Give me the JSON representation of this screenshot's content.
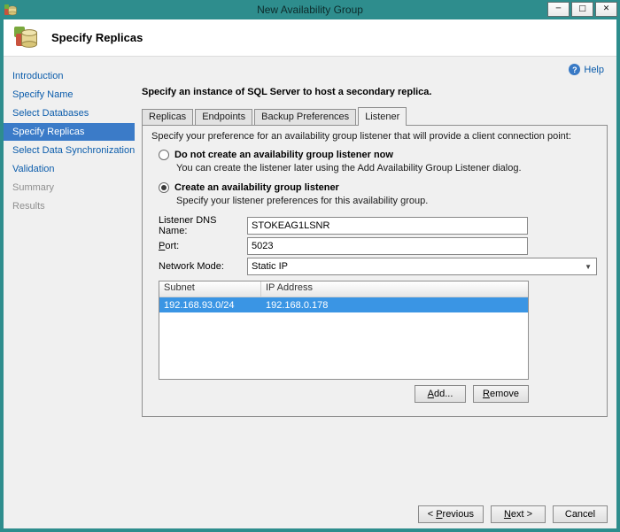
{
  "window": {
    "title": "New Availability Group",
    "controls": {
      "minimize": "─",
      "maximize": "□",
      "close": "✕"
    }
  },
  "header": {
    "title": "Specify Replicas"
  },
  "sidebar": {
    "items": [
      {
        "label": "Introduction",
        "state": "link"
      },
      {
        "label": "Specify Name",
        "state": "link"
      },
      {
        "label": "Select Databases",
        "state": "link"
      },
      {
        "label": "Specify Replicas",
        "state": "active"
      },
      {
        "label": "Select Data Synchronization",
        "state": "link"
      },
      {
        "label": "Validation",
        "state": "link"
      },
      {
        "label": "Summary",
        "state": "disabled"
      },
      {
        "label": "Results",
        "state": "disabled"
      }
    ]
  },
  "main": {
    "help_label": "Help",
    "help_icon_glyph": "?",
    "instruction": "Specify an instance of SQL Server to host a secondary replica.",
    "tabs": [
      {
        "label": "Replicas",
        "active": false
      },
      {
        "label": "Endpoints",
        "active": false
      },
      {
        "label": "Backup Preferences",
        "active": false
      },
      {
        "label": "Listener",
        "active": true
      }
    ],
    "listener": {
      "description": "Specify your preference for an availability group listener that will provide a client connection point:",
      "radio_no_listener": {
        "label": "Do not create an availability group listener now",
        "sublabel": "You can create the listener later using the Add Availability Group Listener dialog.",
        "selected": false
      },
      "radio_create_listener": {
        "label": "Create an availability group listener",
        "sublabel": "Specify your listener preferences for this availability group.",
        "selected": true
      },
      "fields": {
        "dns_name_label": "Listener DNS Name:",
        "dns_name_value": "STOKEAG1LSNR",
        "port_label": "Port:",
        "port_value": "5023",
        "network_mode_label": "Network Mode:",
        "network_mode_value": "Static IP",
        "combo_arrow_glyph": "▼"
      },
      "table": {
        "columns": [
          "Subnet",
          "IP Address"
        ],
        "rows": [
          {
            "subnet": "192.168.93.0/24",
            "ip": "192.168.0.178",
            "selected": true
          }
        ]
      },
      "add_button": "Add...",
      "remove_button": "Remove"
    }
  },
  "footer": {
    "previous": "< Previous",
    "next": "Next >",
    "cancel": "Cancel"
  },
  "colors": {
    "titlebar_teal": "#2e8d8d",
    "sidebar_active_blue": "#3b7bc8",
    "row_selected_blue": "#3a95e4",
    "link_blue": "#0b5cab",
    "help_icon_blue": "#3879c5"
  }
}
